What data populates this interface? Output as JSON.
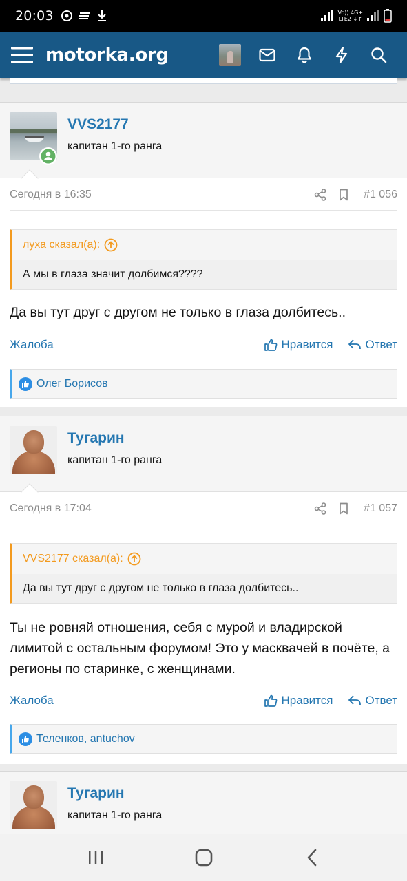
{
  "status_bar": {
    "time": "20:03",
    "network_top": "Vo)) 4G+",
    "network_bottom": "LTE2 ↓↑"
  },
  "header": {
    "logo": "motorka.org"
  },
  "posts": [
    {
      "username": "VVS2177",
      "user_title": "капитан 1-го ранга",
      "date": "Сегодня в 16:35",
      "number": "#1 056",
      "quote_author": "луха сказал(а):",
      "quote_text": "А мы в глаза значит долбимся????",
      "message": "Да вы тут друг с другом не только в глаза долбитесь..",
      "report": "Жалоба",
      "like": "Нравится",
      "reply": "Ответ",
      "likes_by": "Олег Борисов"
    },
    {
      "username": "Тугарин",
      "user_title": "капитан 1-го ранга",
      "date": "Сегодня в 17:04",
      "number": "#1 057",
      "quote_author": "VVS2177 сказал(а):",
      "quote_text": "Да вы тут друг с другом не только в глаза долбитесь..",
      "message": "Ты не ровняй отношения, себя с мурой и владирской лимитой с остальным форумом! Это у масквачей в почёте, а регионы по старинке, с женщинами.",
      "report": "Жалоба",
      "like": "Нравится",
      "reply": "Ответ",
      "likes_by": "Теленков, antuchov"
    },
    {
      "username": "Тугарин",
      "user_title": "капитан 1-го ранга"
    }
  ],
  "colors": {
    "header_bg": "#185886",
    "link": "#2577b1",
    "quote_accent": "#f39a1e",
    "like_accent": "#47a7eb",
    "online": "#63b265"
  }
}
